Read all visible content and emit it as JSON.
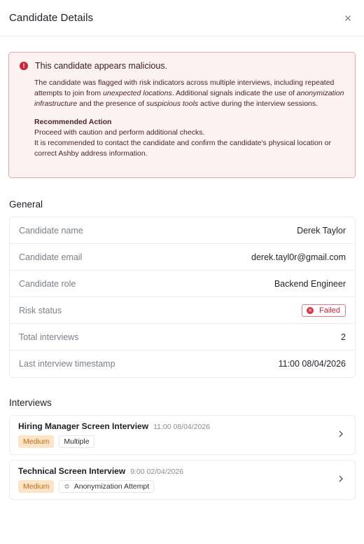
{
  "header": {
    "title": "Candidate Details"
  },
  "alert": {
    "title": "This candidate appears malicious.",
    "body_1": "The candidate was flagged with risk indicators across multiple interviews, including repeated attempts to join from ",
    "body_em_1": "unexpected locations",
    "body_2": ". Additional signals indicate the use of ",
    "body_em_2": "anonymization infrastructure",
    "body_3": " and the presence of ",
    "body_em_3": "suspicious tools",
    "body_4": " active during the interview sessions.",
    "recommended_title": "Recommended Action",
    "recommended_line_1": "Proceed with caution and perform additional checks.",
    "recommended_line_2": "It is recommended to contact the candidate and confirm the candidate's physical location or correct Ashby address information."
  },
  "general": {
    "title": "General",
    "rows": [
      {
        "key": "Candidate name",
        "value": "Derek Taylor"
      },
      {
        "key": "Candidate email",
        "value": "derek.tayl0r@gmail.com"
      },
      {
        "key": "Candidate role",
        "value": "Backend Engineer"
      },
      {
        "key": "Risk status",
        "value": "Failed"
      },
      {
        "key": "Total interviews",
        "value": "2"
      },
      {
        "key": "Last interview timestamp",
        "value": "11:00 08/04/2026"
      }
    ]
  },
  "interviews": {
    "title": "Interviews",
    "items": [
      {
        "name": "Hiring Manager Screen Interview",
        "time": "11:00 08/04/2026",
        "severity": "Medium",
        "tag": "Multiple"
      },
      {
        "name": "Technical Screen Interview",
        "time": "9:00 02/04/2026",
        "severity": "Medium",
        "tag": "Anonymization Attempt"
      }
    ]
  },
  "colors": {
    "danger": "#c8273a",
    "alert_bg": "#fcf2f2",
    "medium_bg": "#fde4c6",
    "medium_text": "#c46a1c"
  }
}
